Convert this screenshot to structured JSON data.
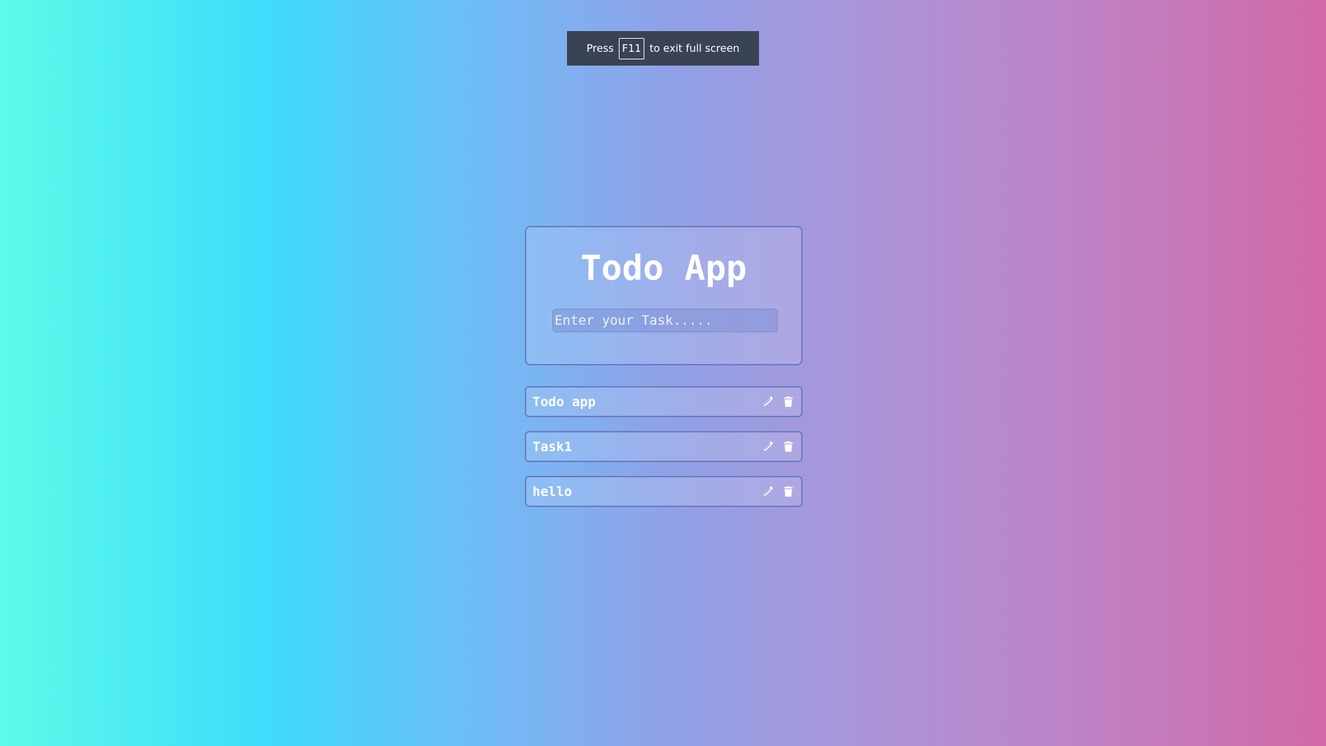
{
  "fullscreen_notice": {
    "before": "Press",
    "key": "F11",
    "after": "to exit full screen"
  },
  "app": {
    "title": "Todo App",
    "input_placeholder": "Enter your Task....."
  },
  "todos": [
    {
      "text": "Todo app",
      "edit_icon": "pencil-icon",
      "delete_icon": "trash-icon"
    },
    {
      "text": "Task1",
      "edit_icon": "pencil-icon",
      "delete_icon": "trash-icon"
    },
    {
      "text": "hello",
      "edit_icon": "pencil-icon",
      "delete_icon": "trash-icon"
    }
  ],
  "colors": {
    "gradient_left": "#5cfbe9",
    "gradient_mid": "#74b8f5",
    "gradient_right": "#d269a6",
    "banner_bg": "#3a4354",
    "card_border": "#6a7bbd"
  }
}
